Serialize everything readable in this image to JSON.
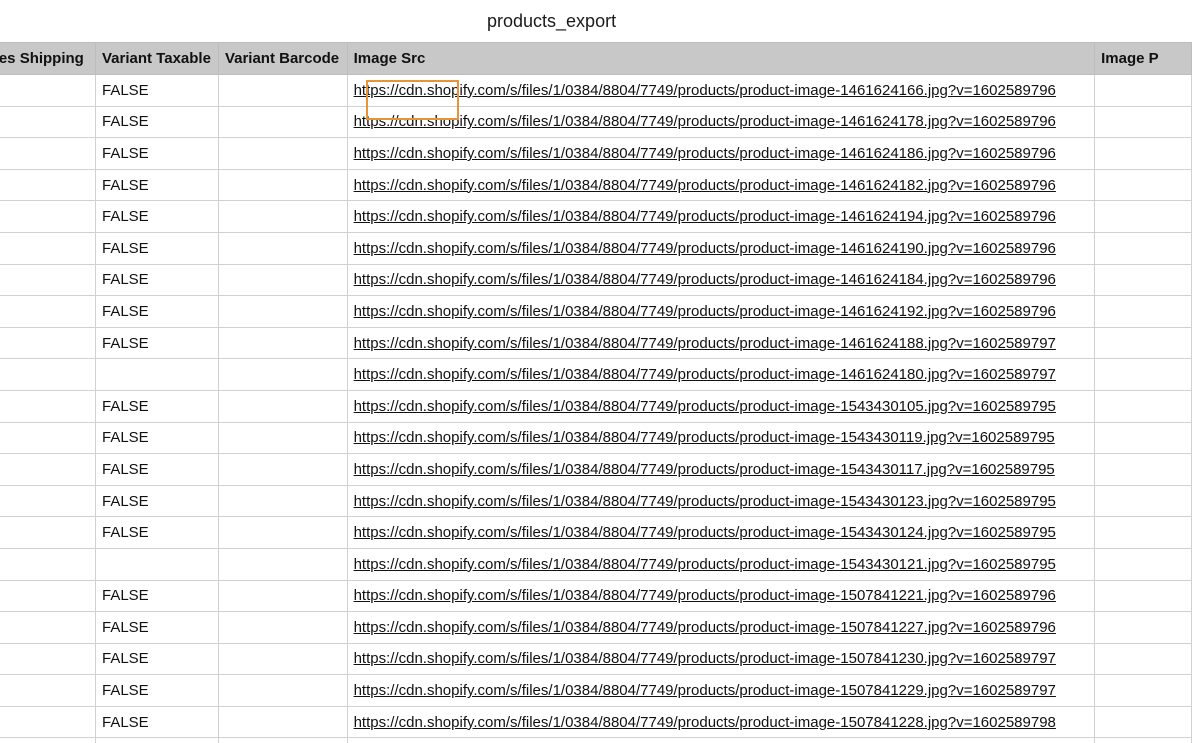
{
  "window": {
    "title": "products_export"
  },
  "headers": [
    "res Shipping",
    "Variant Taxable",
    "Variant Barcode",
    "Image Src",
    "Image P"
  ],
  "highlight": {
    "column": "Image Src",
    "color": "#e8933a"
  },
  "rows": [
    {
      "shipping": "",
      "taxable": "FALSE",
      "barcode": "",
      "image_src": "https://cdn.shopify.com/s/files/1/0384/8804/7749/products/product-image-1461624166.jpg?v=1602589796",
      "image_p": ""
    },
    {
      "shipping": "",
      "taxable": "FALSE",
      "barcode": "",
      "image_src": "https://cdn.shopify.com/s/files/1/0384/8804/7749/products/product-image-1461624178.jpg?v=1602589796",
      "image_p": ""
    },
    {
      "shipping": "",
      "taxable": "FALSE",
      "barcode": "",
      "image_src": "https://cdn.shopify.com/s/files/1/0384/8804/7749/products/product-image-1461624186.jpg?v=1602589796",
      "image_p": ""
    },
    {
      "shipping": "",
      "taxable": "FALSE",
      "barcode": "",
      "image_src": "https://cdn.shopify.com/s/files/1/0384/8804/7749/products/product-image-1461624182.jpg?v=1602589796",
      "image_p": ""
    },
    {
      "shipping": "",
      "taxable": "FALSE",
      "barcode": "",
      "image_src": "https://cdn.shopify.com/s/files/1/0384/8804/7749/products/product-image-1461624194.jpg?v=1602589796",
      "image_p": ""
    },
    {
      "shipping": "",
      "taxable": "FALSE",
      "barcode": "",
      "image_src": "https://cdn.shopify.com/s/files/1/0384/8804/7749/products/product-image-1461624190.jpg?v=1602589796",
      "image_p": ""
    },
    {
      "shipping": "",
      "taxable": "FALSE",
      "barcode": "",
      "image_src": "https://cdn.shopify.com/s/files/1/0384/8804/7749/products/product-image-1461624184.jpg?v=1602589796",
      "image_p": ""
    },
    {
      "shipping": "",
      "taxable": "FALSE",
      "barcode": "",
      "image_src": "https://cdn.shopify.com/s/files/1/0384/8804/7749/products/product-image-1461624192.jpg?v=1602589796",
      "image_p": ""
    },
    {
      "shipping": "",
      "taxable": "FALSE",
      "barcode": "",
      "image_src": "https://cdn.shopify.com/s/files/1/0384/8804/7749/products/product-image-1461624188.jpg?v=1602589797",
      "image_p": ""
    },
    {
      "shipping": "",
      "taxable": "",
      "barcode": "",
      "image_src": "https://cdn.shopify.com/s/files/1/0384/8804/7749/products/product-image-1461624180.jpg?v=1602589797",
      "image_p": ""
    },
    {
      "shipping": "",
      "taxable": "FALSE",
      "barcode": "",
      "image_src": "https://cdn.shopify.com/s/files/1/0384/8804/7749/products/product-image-1543430105.jpg?v=1602589795",
      "image_p": ""
    },
    {
      "shipping": "",
      "taxable": "FALSE",
      "barcode": "",
      "image_src": "https://cdn.shopify.com/s/files/1/0384/8804/7749/products/product-image-1543430119.jpg?v=1602589795",
      "image_p": ""
    },
    {
      "shipping": "",
      "taxable": "FALSE",
      "barcode": "",
      "image_src": "https://cdn.shopify.com/s/files/1/0384/8804/7749/products/product-image-1543430117.jpg?v=1602589795",
      "image_p": ""
    },
    {
      "shipping": "",
      "taxable": "FALSE",
      "barcode": "",
      "image_src": "https://cdn.shopify.com/s/files/1/0384/8804/7749/products/product-image-1543430123.jpg?v=1602589795",
      "image_p": ""
    },
    {
      "shipping": "",
      "taxable": "FALSE",
      "barcode": "",
      "image_src": "https://cdn.shopify.com/s/files/1/0384/8804/7749/products/product-image-1543430124.jpg?v=1602589795",
      "image_p": ""
    },
    {
      "shipping": "",
      "taxable": "",
      "barcode": "",
      "image_src": "https://cdn.shopify.com/s/files/1/0384/8804/7749/products/product-image-1543430121.jpg?v=1602589795",
      "image_p": ""
    },
    {
      "shipping": "",
      "taxable": "FALSE",
      "barcode": "",
      "image_src": "https://cdn.shopify.com/s/files/1/0384/8804/7749/products/product-image-1507841221.jpg?v=1602589796",
      "image_p": ""
    },
    {
      "shipping": "",
      "taxable": "FALSE",
      "barcode": "",
      "image_src": "https://cdn.shopify.com/s/files/1/0384/8804/7749/products/product-image-1507841227.jpg?v=1602589796",
      "image_p": ""
    },
    {
      "shipping": "",
      "taxable": "FALSE",
      "barcode": "",
      "image_src": "https://cdn.shopify.com/s/files/1/0384/8804/7749/products/product-image-1507841230.jpg?v=1602589797",
      "image_p": ""
    },
    {
      "shipping": "",
      "taxable": "FALSE",
      "barcode": "",
      "image_src": "https://cdn.shopify.com/s/files/1/0384/8804/7749/products/product-image-1507841229.jpg?v=1602589797",
      "image_p": ""
    },
    {
      "shipping": "",
      "taxable": "FALSE",
      "barcode": "",
      "image_src": "https://cdn.shopify.com/s/files/1/0384/8804/7749/products/product-image-1507841228.jpg?v=1602589798",
      "image_p": ""
    },
    {
      "shipping": "",
      "taxable": "",
      "barcode": "",
      "image_src": "",
      "image_p": ""
    }
  ]
}
